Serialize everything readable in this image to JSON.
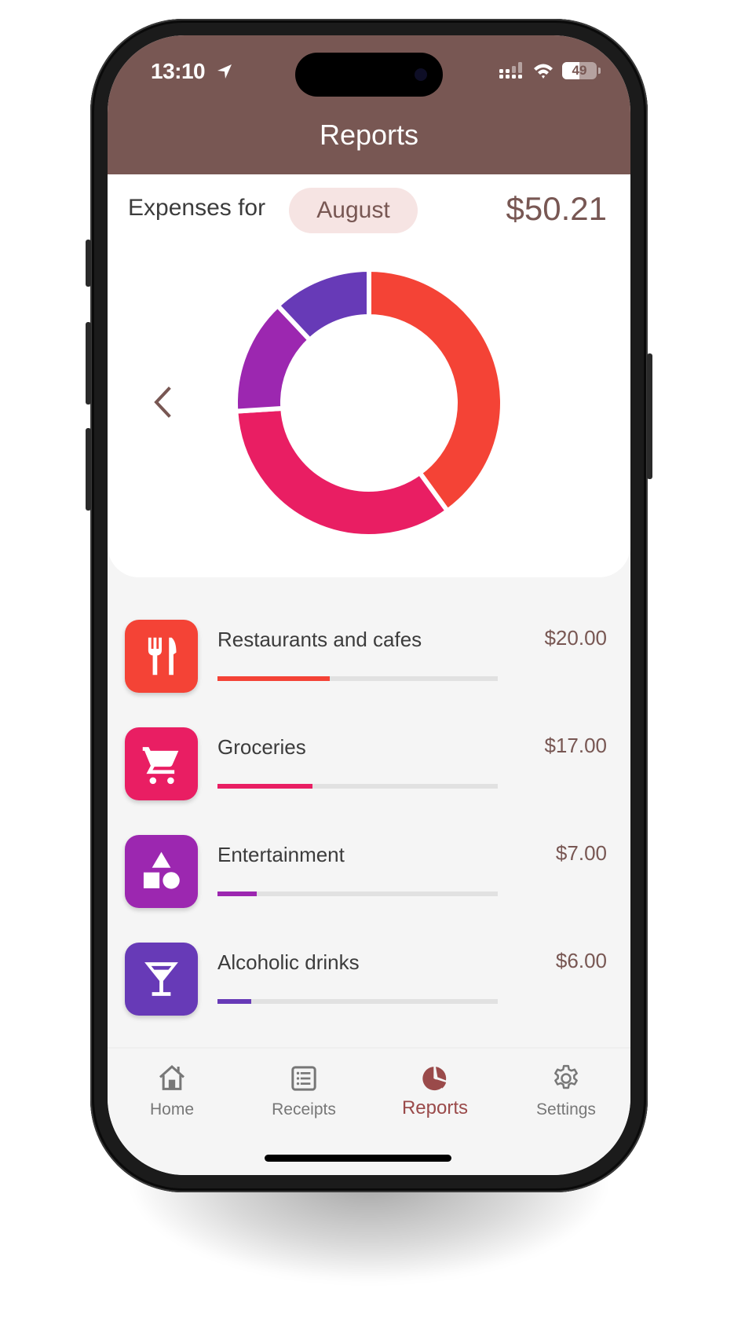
{
  "status_bar": {
    "time": "13:10",
    "battery_level": "49",
    "battery_fraction": 0.49
  },
  "header": {
    "title": "Reports"
  },
  "summary": {
    "label": "Expenses for",
    "month": "August",
    "total": "$50.21"
  },
  "colors": {
    "brand": "#785753",
    "restaurants": "#f44336",
    "groceries": "#e91e63",
    "entertainment": "#9c27b0",
    "alcohol": "#673ab7"
  },
  "chart_data": {
    "type": "pie",
    "variant": "donut",
    "title": "",
    "categories": [
      "Restaurants and cafes",
      "Groceries",
      "Entertainment",
      "Alcoholic drinks"
    ],
    "values": [
      20.0,
      17.0,
      7.0,
      6.0
    ],
    "colors": [
      "#f44336",
      "#e91e63",
      "#9c27b0",
      "#673ab7"
    ],
    "start_angle_deg": 0,
    "direction": "clockwise",
    "legend": "none"
  },
  "categories": [
    {
      "name": "Restaurants and cafes",
      "amount": "$20.00",
      "share": 0.4,
      "icon": "restaurant-icon",
      "color": "#f44336"
    },
    {
      "name": "Groceries",
      "amount": "$17.00",
      "share": 0.34,
      "icon": "shopping-cart-icon",
      "color": "#e91e63"
    },
    {
      "name": "Entertainment",
      "amount": "$7.00",
      "share": 0.14,
      "icon": "shapes-icon",
      "color": "#9c27b0"
    },
    {
      "name": "Alcoholic drinks",
      "amount": "$6.00",
      "share": 0.12,
      "icon": "cocktail-icon",
      "color": "#673ab7"
    }
  ],
  "nav": {
    "items": [
      {
        "label": "Home",
        "icon": "home-icon",
        "active": false
      },
      {
        "label": "Receipts",
        "icon": "receipt-list-icon",
        "active": false
      },
      {
        "label": "Reports",
        "icon": "pie-chart-icon",
        "active": true
      },
      {
        "label": "Settings",
        "icon": "gear-icon",
        "active": false
      }
    ]
  }
}
